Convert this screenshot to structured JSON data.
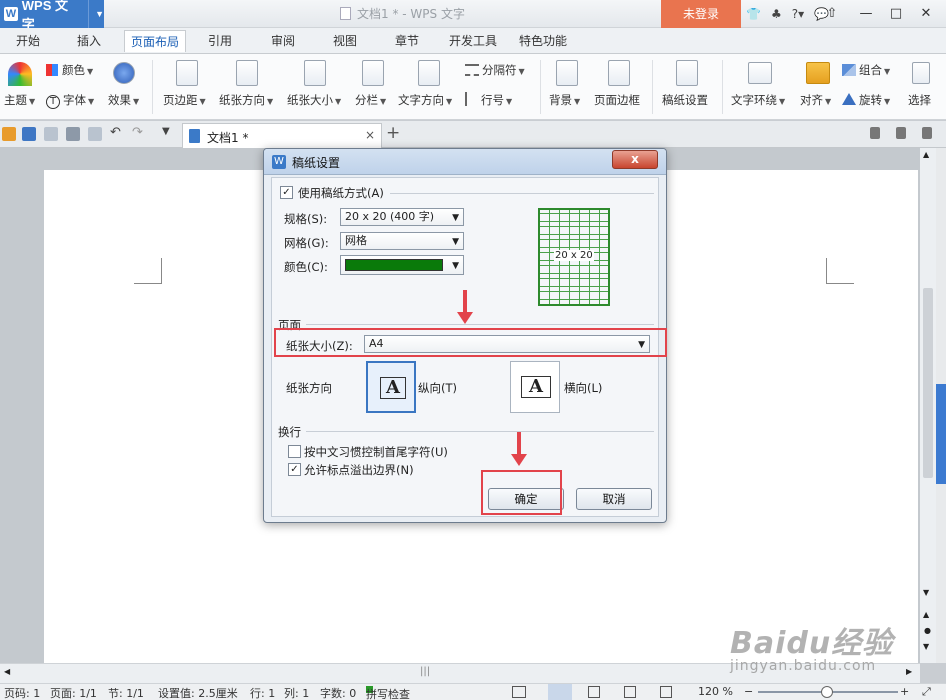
{
  "app": {
    "name": "WPS 文字",
    "window_title": "文档1 * - WPS 文字",
    "login": "未登录"
  },
  "menu_tabs": [
    "开始",
    "插入",
    "页面布局",
    "引用",
    "审阅",
    "视图",
    "章节",
    "开发工具",
    "特色功能"
  ],
  "active_tab": "页面布局",
  "ribbon": {
    "color": "颜色",
    "theme": "主题",
    "font": "字体",
    "effect": "效果",
    "margins": "页边距",
    "orientation": "纸张方向",
    "size": "纸张大小",
    "columns": "分栏",
    "text_direction": "文字方向",
    "separator": "分隔符",
    "line_no": "行号",
    "background": "背景",
    "page_border": "页面边框",
    "draft_paper": "稿纸设置",
    "wrap": "文字环绕",
    "align": "对齐",
    "group": "组合",
    "rotate": "旋转",
    "select": "选择"
  },
  "doc_tab": {
    "label": "文档1 *",
    "close": "×",
    "add": "+"
  },
  "dialog": {
    "title": "稿纸设置",
    "close": "x",
    "use_draft": "使用稿纸方式(A)",
    "use_draft_checked": true,
    "spec_label": "规格(S):",
    "spec_value": "20 x 20 (400 字)",
    "grid_label": "网格(G):",
    "grid_value": "网格",
    "color_label": "颜色(C):",
    "color_value": "#0a7a0a",
    "preview_text": "20 x 20",
    "page_section": "页面",
    "paper_size_label": "纸张大小(Z):",
    "paper_size_value": "A4",
    "orientation_label": "纸张方向",
    "portrait": "纵向(T)",
    "landscape": "横向(L)",
    "portrait_glyph": "A",
    "landscape_glyph": "A",
    "wrap_section": "换行",
    "chk_chinese": "按中文习惯控制首尾字符(U)",
    "chk_chinese_checked": false,
    "chk_punct": "允许标点溢出边界(N)",
    "chk_punct_checked": true,
    "ok": "确定",
    "cancel": "取消"
  },
  "status": {
    "page_code": "页码: 1",
    "pages": "页面: 1/1",
    "section": "节: 1/1",
    "setting": "设置值: 2.5厘米",
    "row": "行: 1",
    "col": "列: 1",
    "words": "字数: 0",
    "spell": "拼写检查",
    "zoom": "120 %",
    "minus": "−",
    "plus": "+"
  },
  "watermark": {
    "brand": "Baidu经验",
    "url": "jingyan.baidu.com"
  },
  "colors": {
    "accent": "#3b7ac8",
    "login": "#e9744f",
    "highlight": "#e2434b",
    "draft_green": "#0a7a0a"
  }
}
